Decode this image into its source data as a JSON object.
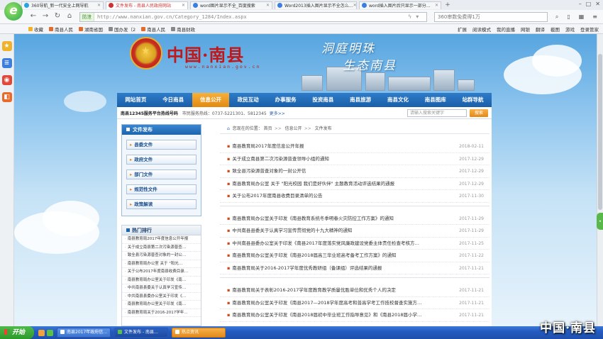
{
  "browser": {
    "tabs": [
      {
        "label": "360导航_新一代安全上网导航",
        "active": false
      },
      {
        "label": "文件发布 - 南县人民政府网站",
        "active": true
      },
      {
        "label": "word图片显示不全_百度搜索",
        "active": false
      },
      {
        "label": "Word2013插入图片显示不全怎么…",
        "active": false
      },
      {
        "label": "word插入图片后只显示一部分…",
        "active": false
      }
    ],
    "safe_label": "防泄",
    "url": "http://www.nanxian.gov.cn/Category_1284/Index.aspx",
    "search_placeholder": "360审数免费得1万",
    "favorites": [
      {
        "label": "收藏"
      },
      {
        "label": "南县人民"
      },
      {
        "label": "湖南省国"
      },
      {
        "label": "国办发〔2"
      },
      {
        "label": "南县人民"
      },
      {
        "label": "南县财政"
      }
    ],
    "toolbar_right": [
      "扩展",
      "阅读模式",
      "我的直播",
      "网银",
      "翻译",
      "截图",
      "游戏",
      "登录管家"
    ]
  },
  "site": {
    "title": "中国·南县",
    "url_text": "www.nanxian.gov.cn",
    "slogan_line1": "洞庭明珠",
    "slogan_line2": "生态南县",
    "nav": [
      {
        "label": "网站首页",
        "active": false
      },
      {
        "label": "今日南县",
        "active": false
      },
      {
        "label": "信息公开",
        "active": true
      },
      {
        "label": "政民互动",
        "active": false
      },
      {
        "label": "办事服务",
        "active": false
      },
      {
        "label": "投资南县",
        "active": false
      },
      {
        "label": "南县旅游",
        "active": false
      },
      {
        "label": "南县文化",
        "active": false
      },
      {
        "label": "南县图库",
        "active": false
      },
      {
        "label": "站群导航",
        "active": false
      }
    ],
    "hotline_label": "南县12345服务平台热线号码",
    "hotline_phones": "市民服务热线：0737-5221301、5812345",
    "more_label": "更多>>",
    "search_placeholder": "请输入搜索关键字",
    "search_button": "搜索"
  },
  "left_panel": {
    "title": "文件发布",
    "categories": [
      "县委文件",
      "政府文件",
      "部门文件",
      "规范性文件",
      "政策解读"
    ]
  },
  "hot": {
    "title": "热门排行",
    "items": [
      "南县教育局2017年度信息公开年报",
      "关于成立南县第二次污染源普查…",
      "致全县污染源普查对象的一封公…",
      "南县教育局办公室 关于 \"阳光…",
      "关于公布2017年度南县收费目录…",
      "南县教育局办公室关于印发《南…",
      "中共南县县委关于认真学习宣传…",
      "中共南县县委办公室关于印发《…",
      "南县教育局办公室关于印发《南…",
      "南县教育局关于2016-2017学年…"
    ]
  },
  "breadcrumb": {
    "prefix": "您现在的位置：",
    "items": [
      "首页",
      "信息公开",
      "文件发布"
    ]
  },
  "articles": {
    "group1": [
      {
        "title": "南县教育局2017年度信息公开年报",
        "date": "2018-02-11"
      },
      {
        "title": "关于成立南县第二次污染源普查领导小组的通知",
        "date": "2017-12-29"
      },
      {
        "title": "致全县污染源普查对象的一封公开信",
        "date": "2017-12-29"
      },
      {
        "title": "南县教育局办公室 关于 \"阳光校园 我们是好伙伴\" 主题教育活动评选结果的通报",
        "date": "2017-12-29"
      },
      {
        "title": "关于公布2017年度南县收费目录清单的公告",
        "date": "2017-11-30"
      }
    ],
    "group2": [
      {
        "title": "南县教育局办公室关于印发《南县教育系统冬季明春火灾防控工作方案》的通知",
        "date": "2017-11-29"
      },
      {
        "title": "中共南县县委关于认真学习宣传贯彻党的十九大精神的通知",
        "date": "2017-11-29"
      },
      {
        "title": "中共南县县委办公室关于印发《南县2017年度落实党风廉政建设党委主体责任检查考核方…",
        "date": "2017-11-25"
      },
      {
        "title": "南县教育局办公室关于印发《南县2018届高三毕业班高考备考工作方案》的通知",
        "date": "2017-11-22"
      },
      {
        "title": "南县教育局关于2016-2017学年度优秀教研组（备课组）评选结果的通报",
        "date": "2017-11-21"
      }
    ],
    "group3": [
      {
        "title": "南县教育局关于表彰2016-2017学年度教育教学质量优胜单位和优秀个人的决定",
        "date": "2017-11-21"
      },
      {
        "title": "南县教育局办公室关于印发《南县2017—2018学年度高考和普高学考工作技校督查实施方…",
        "date": "2017-11-21"
      },
      {
        "title": "南县教育局办公室关于印发《南县2018届初中毕业班工作指导意见》和《南县2018届小学…",
        "date": "2017-11-21"
      }
    ]
  },
  "taskbar": {
    "start_label": "开始",
    "tasks": [
      {
        "label": "南县2017年政府信…"
      },
      {
        "label": "文件发布 - 南县…"
      },
      {
        "label": "热点资讯"
      }
    ],
    "caption": "中国·南县"
  }
}
